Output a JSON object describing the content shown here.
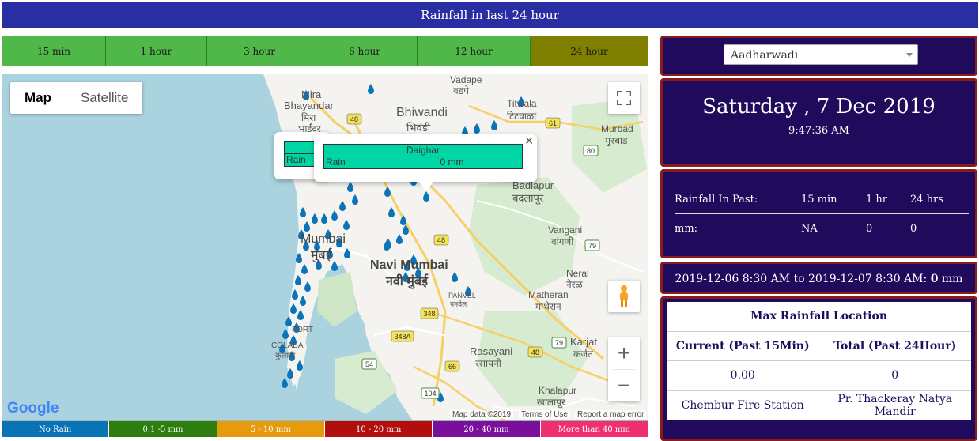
{
  "title": "Rainfall in last 24 hour",
  "tabs": [
    {
      "label": "15 min"
    },
    {
      "label": "1 hour"
    },
    {
      "label": "3 hour"
    },
    {
      "label": "6 hour"
    },
    {
      "label": "12 hour"
    },
    {
      "label": "24 hour"
    }
  ],
  "active_tab": "24 hour",
  "map": {
    "type_map": "Map",
    "type_satellite": "Satellite",
    "popup": {
      "title": "Daighar",
      "rain_label": "Rain",
      "rain_value": "0 mm"
    },
    "popup_back": {
      "rain_label": "Rain"
    },
    "attribution": {
      "data": "Map data ©2019",
      "terms": "Terms of Use",
      "report": "Report a map error"
    },
    "logo": "Google",
    "labels": {
      "mira": "Mira",
      "bhayandar": "Bhayandar",
      "bhayandar_dev": "मिरा",
      "bhayandar_dev2": "भाईंदर",
      "vadape": "Vadape",
      "vadape_dev": "वडपे",
      "bhiwandi": "Bhiwandi",
      "bhiwandi_dev": "भिवंडी",
      "titwala": "Titwala",
      "titwala_dev": "टिटवाळा",
      "murbad": "Murbad",
      "murbad_dev": "मुरबाड",
      "badlapur": "Badlapur",
      "badlapur_dev": "बदलापूर",
      "mumbai": "Mumbai",
      "mumbai_dev": "मुंबई",
      "navi_mumbai": "Navi Mumbai",
      "navi_mumbai_dev": "नवी मुंबई",
      "vangani": "Vangani",
      "vangani_dev": "वांगणी",
      "neral": "Neral",
      "neral_dev": "नेरळ",
      "panvel": "PANVEL",
      "panvel_dev": "पनवेल",
      "matheran": "Matheran",
      "matheran_dev": "माथेरान",
      "karjat": "Karjat",
      "karjat_dev": "कर्जत",
      "rasayani": "Rasayani",
      "rasayani_dev": "रसायनी",
      "khalapur": "Khalapur",
      "khalapur_dev": "खालापूर",
      "fort": "FORT",
      "colaba": "COLABA",
      "colaba_dev": "कुलाबा"
    },
    "road_shields": {
      "r48a": "48",
      "r61": "61",
      "r80": "80",
      "r48b": "48",
      "r79a": "79",
      "r348": "348",
      "r348a": "348A",
      "r54": "54",
      "r66": "66",
      "r104": "104",
      "r48c": "48",
      "r79b": "79"
    }
  },
  "legend": [
    {
      "label": "No Rain",
      "color": "#0a73b5"
    },
    {
      "label": "0.1 -5 mm",
      "color": "#2e7d0f"
    },
    {
      "label": "5 - 10 mm",
      "color": "#e69a0e"
    },
    {
      "label": "10 - 20 mm",
      "color": "#b30e0e"
    },
    {
      "label": "20 - 40 mm",
      "color": "#7b0f9c"
    },
    {
      "label": "More than 40 mm",
      "color": "#f0306e"
    }
  ],
  "station_select": {
    "value": "Aadharwadi"
  },
  "datetime": {
    "date": "Saturday , 7 Dec 2019",
    "time": "9:47:36 AM"
  },
  "rainfall_past": {
    "label": "Rainfall In Past:",
    "col_15": "15 min",
    "col_1h": "1 hr",
    "col_24h": "24 hrs",
    "unit": "mm:",
    "val_15": "NA",
    "val_1h": "0",
    "val_24h": "0"
  },
  "range": {
    "text": "2019-12-06 8:30 AM to 2019-12-07 8:30 AM:",
    "value": "0",
    "unit": "mm"
  },
  "max_rain": {
    "title": "Max Rainfall Location",
    "current_label": "Current (Past 15Min)",
    "total_label": "Total (Past 24Hour)",
    "current_value": "0.00",
    "total_value": "0",
    "current_location": "Chembur Fire Station",
    "total_location": "Pr. Thackeray Natya Mandir"
  }
}
